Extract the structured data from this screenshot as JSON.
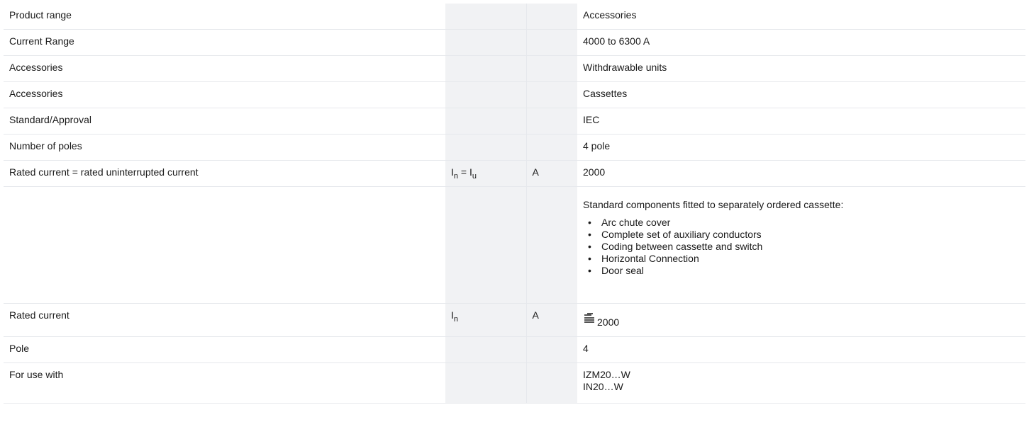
{
  "rows": [
    {
      "label": "Product range",
      "value": "Accessories"
    },
    {
      "label": "Current Range",
      "value": "4000 to 6300 A"
    },
    {
      "label": "Accessories",
      "value": "Withdrawable units"
    },
    {
      "label": "Accessories",
      "value": "Cassettes"
    },
    {
      "label": "Standard/Approval",
      "value": "IEC"
    },
    {
      "label": "Number of poles",
      "value": "4 pole"
    },
    {
      "label": "Rated current = rated uninterrupted current",
      "symbol_main_1": "I",
      "symbol_sub_1": "n",
      "symbol_mid": " = ",
      "symbol_main_2": "I",
      "symbol_sub_2": "u",
      "unit": "A",
      "value": "2000"
    }
  ],
  "note": {
    "intro": "Standard components fitted to separately ordered cassette:",
    "items": [
      "Arc chute cover",
      "Complete set of auxiliary conductors",
      "Coding between cassette and switch",
      "Horizontal Connection",
      "Door seal"
    ],
    "bullet": "•"
  },
  "rated_current": {
    "label": "Rated current",
    "symbol_main": "I",
    "symbol_sub": "n",
    "unit": "A",
    "icon": "rated-current-symbol-icon",
    "value": "2000"
  },
  "pole": {
    "label": "Pole",
    "value": "4"
  },
  "for_use_with": {
    "label": "For use with",
    "values": [
      "IZM20…W",
      "IN20…W"
    ]
  }
}
